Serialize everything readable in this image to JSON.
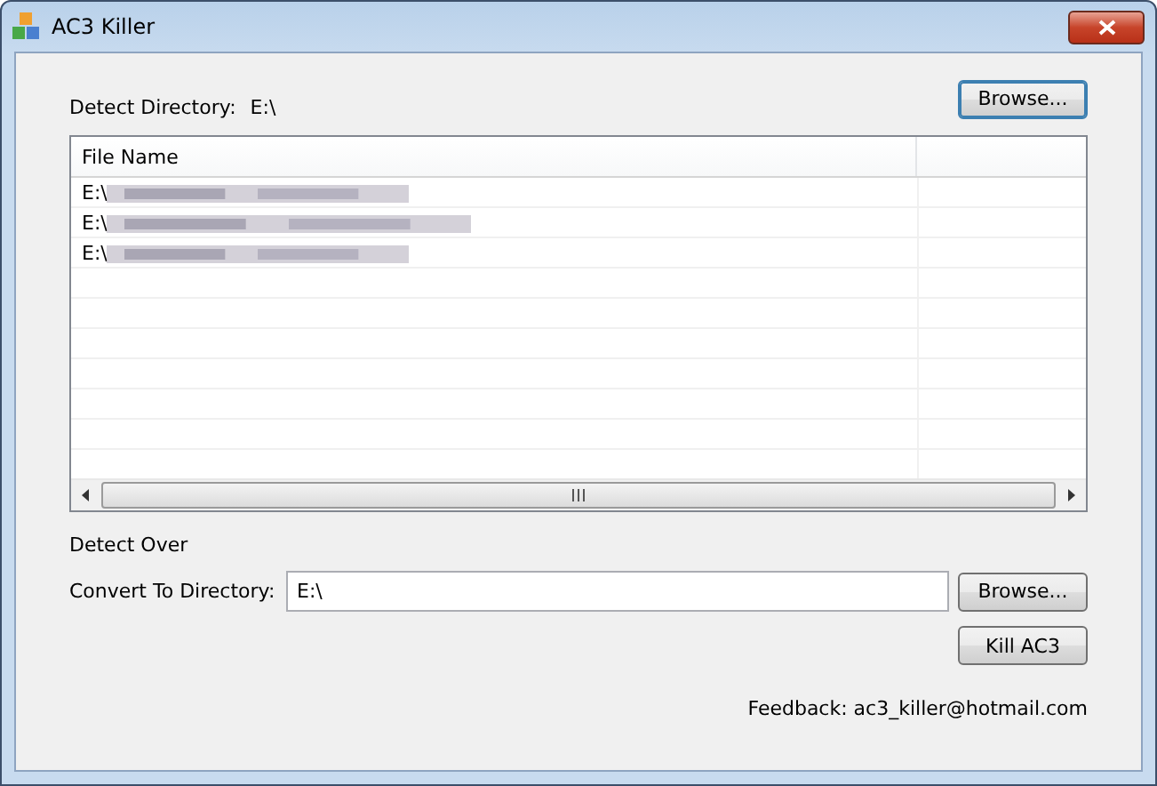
{
  "window": {
    "title": "AC3 Killer"
  },
  "detect": {
    "label": "Detect Directory:",
    "value": "E:\\",
    "button": "Browse..."
  },
  "file_list": {
    "columns": [
      "File Name"
    ],
    "rows": [
      {
        "file_name": "E:\\"
      },
      {
        "file_name": "E:\\"
      },
      {
        "file_name": "E:\\"
      }
    ]
  },
  "status": "Detect Over",
  "convert": {
    "label": "Convert To Directory:",
    "value": "E:\\",
    "button": "Browse..."
  },
  "kill_button": "Kill AC3",
  "feedback": "Feedback: ac3_killer@hotmail.com"
}
